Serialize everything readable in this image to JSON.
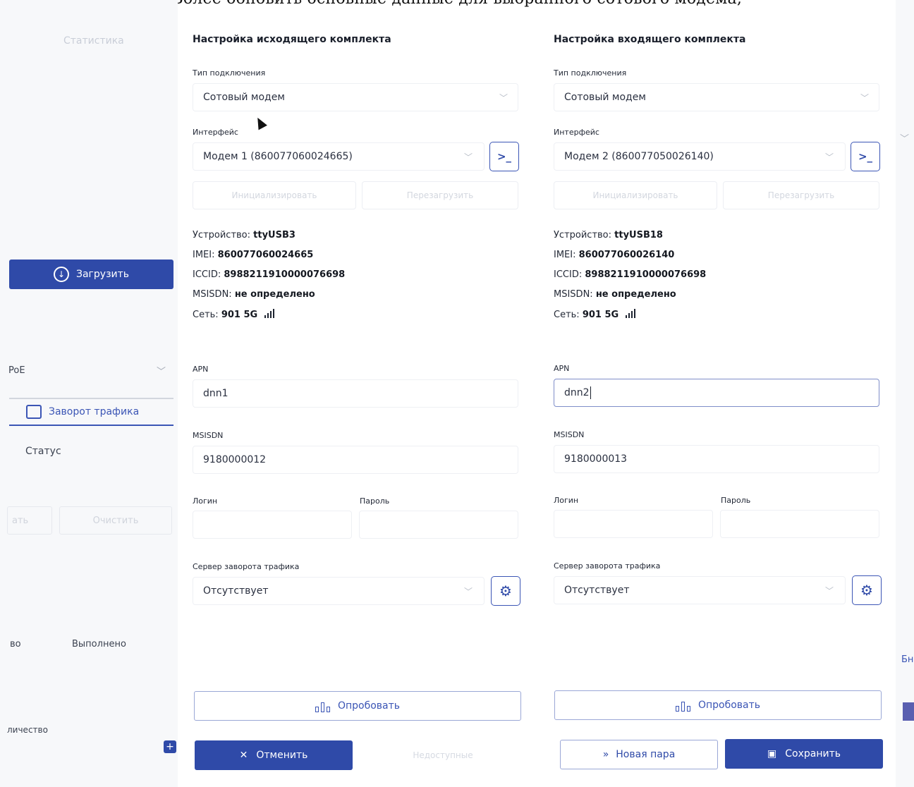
{
  "caption": "Более обновить основные данные для выбранного сотового модема;",
  "background": {
    "statistics_label": "Статистика",
    "upload_label": "Загрузить",
    "poe_label": "PoE",
    "traffic_loop_tab": "Заворот трафика",
    "status_label": "Статус",
    "ghost_button_1": "ать",
    "clear_label": "Очистить",
    "vo_label": "во",
    "done_label": "Выполнено",
    "quantity_label": "личество",
    "right_edge_text": "Бн"
  },
  "outgoing": {
    "heading": "Настройка исходящего комплекта",
    "connection_type_label": "Тип подключения",
    "connection_type_value": "Сотовый модем",
    "interface_label": "Интерфейс",
    "interface_value": "Модем 1 (860077060024665)",
    "terminal_symbol": ">_",
    "init_label": "Инициализировать",
    "reboot_label": "Перезагрузить",
    "device_label": "Устройство:",
    "device_value": "ttyUSB3",
    "imei_label": "IMEI:",
    "imei_value": "860077060024665",
    "iccid_label": "ICCID:",
    "iccid_value": "8988211910000076698",
    "msisdn_info_label": "MSISDN:",
    "msisdn_info_value": "не определено",
    "network_label": "Сеть:",
    "network_value": "901 5G",
    "apn_label": "APN",
    "apn_value": "dnn1",
    "msisdn_label": "MSISDN",
    "msisdn_value": "9180000012",
    "login_label": "Логин",
    "password_label": "Пароль",
    "server_label": "Сервер заворота трафика",
    "server_value": "Отсутствует",
    "test_button": "Опробовать"
  },
  "incoming": {
    "heading": "Настройка входящего комплекта",
    "connection_type_label": "Тип подключения",
    "connection_type_value": "Сотовый модем",
    "interface_label": "Интерфейс",
    "interface_value": "Модем 2 (860077050026140)",
    "terminal_symbol": ">_",
    "init_label": "Инициализировать",
    "reboot_label": "Перезагрузить",
    "device_label": "Устройство:",
    "device_value": "ttyUSB18",
    "imei_label": "IMEI:",
    "imei_value": "860077060026140",
    "iccid_label": "ICCID:",
    "iccid_value": "8988211910000076698",
    "msisdn_info_label": "MSISDN:",
    "msisdn_info_value": "не определено",
    "network_label": "Сеть:",
    "network_value": "901 5G",
    "apn_label": "APN",
    "apn_value": "dnn2",
    "msisdn_label": "MSISDN",
    "msisdn_value": "9180000013",
    "login_label": "Логин",
    "password_label": "Пароль",
    "server_label": "Сервер заворота трафика",
    "server_value": "Отсутствует",
    "test_button": "Опробовать"
  },
  "footer": {
    "cancel_button": "Отменить",
    "unavailable_label": "Недоступные",
    "new_pair_button": "Новая пара",
    "save_button": "Сохранить"
  },
  "colors": {
    "accent": "#2f4aa8",
    "text": "#1f2533",
    "muted": "#d3d7df"
  }
}
